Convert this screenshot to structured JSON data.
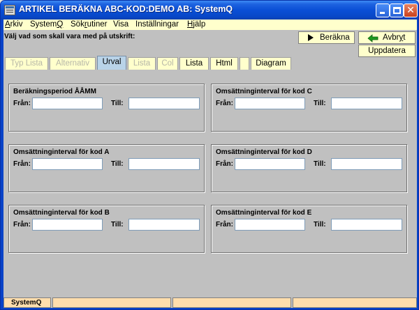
{
  "window": {
    "title": "ARTIKEL BERÄKNA ABC-KOD:DEMO AB: SystemQ",
    "close_glyph": "✕"
  },
  "menu": [
    {
      "label": "Arkiv",
      "u": "A",
      "rest": "rkiv"
    },
    {
      "label": "SystemQ",
      "pre": "System",
      "u": "Q",
      "rest": ""
    },
    {
      "label": "Sökrutiner",
      "pre": "Sök",
      "u": "r",
      "rest": "utiner"
    },
    {
      "label": "Visa",
      "pre": "",
      "u": "",
      "rest": "Visa"
    },
    {
      "label": "Inställningar",
      "pre": "",
      "u": "",
      "rest": "Inställningar"
    },
    {
      "label": "Hjälp",
      "u": "H",
      "rest": "jälp"
    }
  ],
  "instruction": "Välj vad som skall vara med på utskrift:",
  "buttons": {
    "calculate": "Beräkna",
    "cancel_pre": "Avbr",
    "cancel_u": "y",
    "cancel_post": "t",
    "update": "Uppdatera"
  },
  "tabs": [
    {
      "label": "Typ Lista",
      "state": "disabled"
    },
    {
      "label": "Alternativ",
      "state": "disabled"
    },
    {
      "label": "Urval",
      "state": "active"
    },
    {
      "label": "Lista",
      "state": "disabled"
    },
    {
      "label": "Col",
      "state": "disabled"
    },
    {
      "label": "Lista",
      "state": "normal"
    },
    {
      "label": "Html",
      "state": "normal"
    },
    {
      "label": "",
      "state": "normal"
    },
    {
      "label": "Diagram",
      "state": "normal"
    }
  ],
  "groups": {
    "period": {
      "title": "Beräkningsperiod   ÅÅMM",
      "from_label": "Från:",
      "to_label": "Till:",
      "from_value": "",
      "to_value": ""
    },
    "code_a": {
      "title": "Omsättninginterval för kod A",
      "from_label": "Från:",
      "to_label": "Till:",
      "from_value": "",
      "to_value": ""
    },
    "code_b": {
      "title": "Omsättninginterval för kod B",
      "from_label": "Från:",
      "to_label": "Till:",
      "from_value": "",
      "to_value": ""
    },
    "code_c": {
      "title": "Omsättninginterval för kod C",
      "from_label": "Från:",
      "to_label": "Till:",
      "from_value": "",
      "to_value": ""
    },
    "code_d": {
      "title": "Omsättninginterval för kod D",
      "from_label": "Från:",
      "to_label": "Till:",
      "from_value": "",
      "to_value": ""
    },
    "code_e": {
      "title": "Omsättninginterval för kod E",
      "from_label": "Från:",
      "to_label": "Till:",
      "from_value": "",
      "to_value": ""
    }
  },
  "statusbar": [
    "SystemQ",
    "",
    "",
    ""
  ],
  "colors": {
    "menu_bg": "#ffffcc",
    "tab_active_bg": "#b9d3e8",
    "status_bg": "#ffdead",
    "panel_bg": "#c0c0c0",
    "arrow_green": "#1f9a1f"
  },
  "icons": {
    "calculate": "play-icon",
    "cancel": "back-arrow-icon"
  }
}
